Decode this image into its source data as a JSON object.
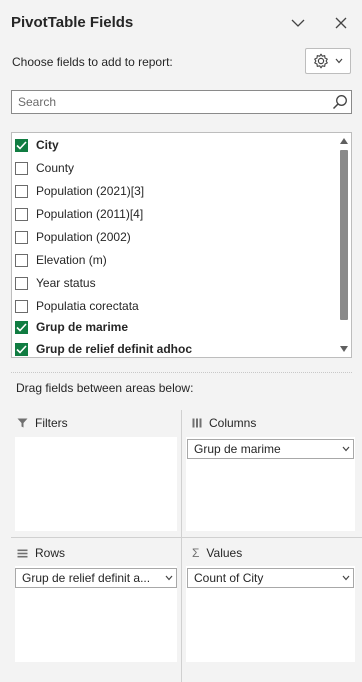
{
  "panel": {
    "title": "PivotTable Fields",
    "choose_label": "Choose fields to add to report:",
    "search_placeholder": "Search",
    "drag_label": "Drag fields between areas below:"
  },
  "fields": [
    {
      "label": "City",
      "checked": true
    },
    {
      "label": "County",
      "checked": false
    },
    {
      "label": "Population (2021)[3]",
      "checked": false
    },
    {
      "label": "Population (2011)[4]",
      "checked": false
    },
    {
      "label": "Population (2002)",
      "checked": false
    },
    {
      "label": "Elevation (m)",
      "checked": false
    },
    {
      "label": "Year status",
      "checked": false
    },
    {
      "label": "Populatia corectata",
      "checked": false
    },
    {
      "label": "Grup de marime",
      "checked": true
    },
    {
      "label": "Grup de relief definit adhoc",
      "checked": true
    }
  ],
  "areas": {
    "filters": {
      "label": "Filters"
    },
    "columns": {
      "label": "Columns",
      "items": [
        "Grup de marime"
      ]
    },
    "rows": {
      "label": "Rows",
      "items": [
        "Grup de relief definit a..."
      ]
    },
    "values": {
      "label": "Values",
      "items": [
        "Count of City"
      ]
    }
  },
  "colors": {
    "check_green": "#107c41"
  },
  "icons": [
    "chevron-down-icon",
    "close-icon",
    "gear-icon",
    "search-icon",
    "filter-icon",
    "columns-icon",
    "rows-icon",
    "sigma-icon"
  ]
}
